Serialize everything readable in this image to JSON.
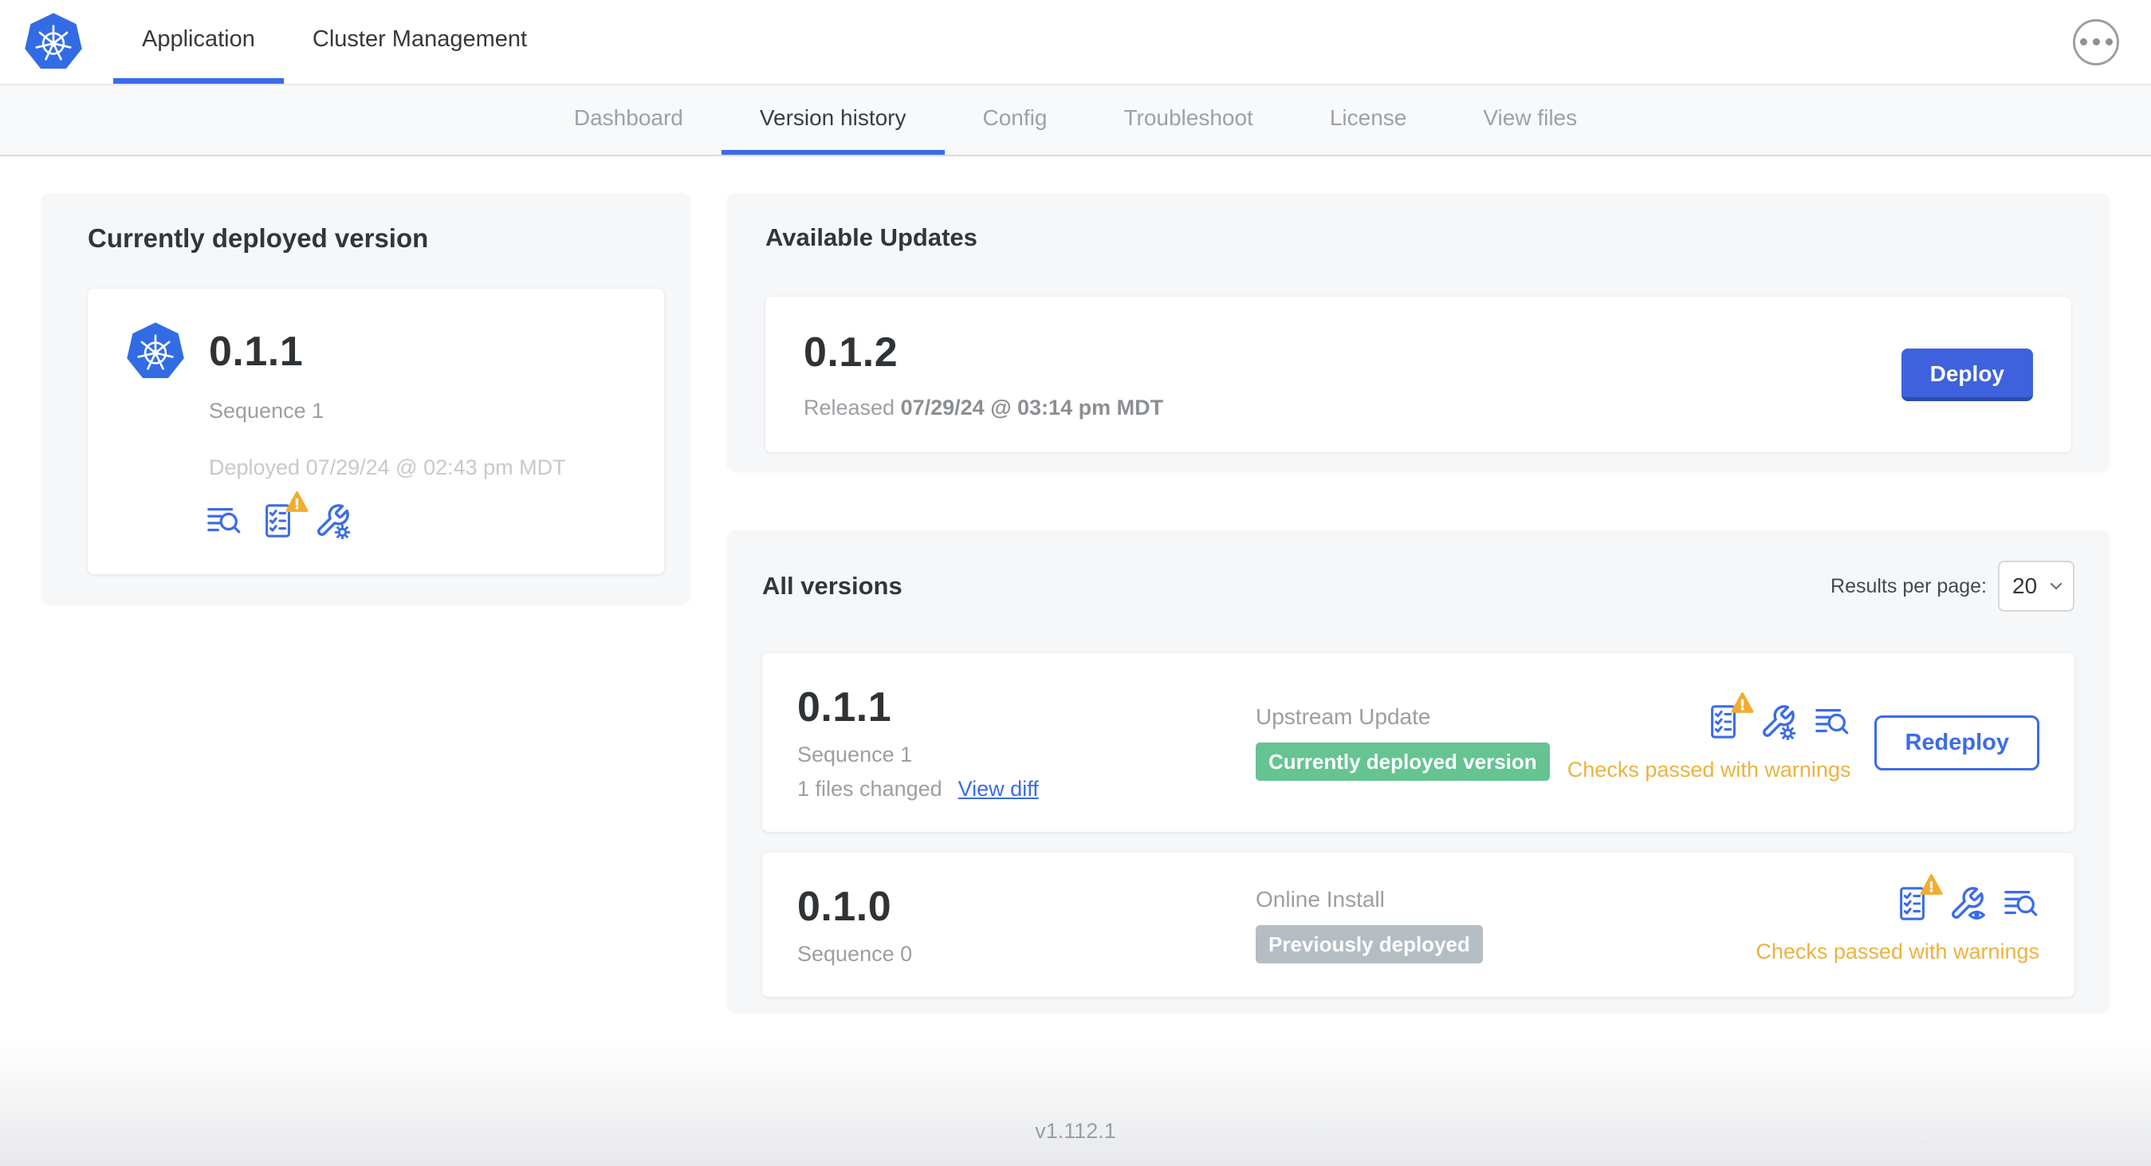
{
  "header": {
    "tabs": [
      {
        "label": "Application",
        "active": true
      },
      {
        "label": "Cluster Management",
        "active": false
      }
    ]
  },
  "subnav": {
    "tabs": [
      {
        "label": "Dashboard",
        "active": false
      },
      {
        "label": "Version history",
        "active": true
      },
      {
        "label": "Config",
        "active": false
      },
      {
        "label": "Troubleshoot",
        "active": false
      },
      {
        "label": "License",
        "active": false
      },
      {
        "label": "View files",
        "active": false
      }
    ]
  },
  "current_version": {
    "title": "Currently deployed version",
    "version": "0.1.1",
    "sequence": "Sequence 1",
    "deployed": "Deployed 07/29/24 @ 02:43 pm MDT"
  },
  "available_updates": {
    "title": "Available Updates",
    "version": "0.1.2",
    "released_prefix": "Released",
    "released_timestamp": "07/29/24 @ 03:14 pm MDT",
    "deploy_label": "Deploy"
  },
  "all_versions": {
    "title": "All versions",
    "results_per_page_label": "Results per page:",
    "results_per_page_value": "20",
    "rows": [
      {
        "version": "0.1.1",
        "sequence": "Sequence 1",
        "files_changed": "1 files changed",
        "view_diff": "View diff",
        "source": "Upstream Update",
        "badge": "Currently deployed version",
        "status": "Checks passed with warnings",
        "action": "Redeploy"
      },
      {
        "version": "0.1.0",
        "sequence": "Sequence 0",
        "source": "Online Install",
        "badge": "Previously deployed",
        "status": "Checks passed with warnings"
      }
    ]
  },
  "footer": {
    "app_version": "v1.112.1"
  },
  "icons": {
    "logo": "kubernetes-logo",
    "menu": "ellipsis-icon",
    "logs": "logs-icon",
    "preflight": "preflight-checks-icon",
    "warning": "warning-triangle-icon",
    "config_gear": "wrench-gear-icon",
    "config_eye": "wrench-eye-icon",
    "chevron": "chevron-down-icon"
  },
  "colors": {
    "logo_blue": "#326CE5",
    "accent_blue": "#3b6ce8",
    "button_blue": "#3e62dd",
    "green_badge": "#65c492",
    "gray_badge": "#b4bec2",
    "warning_amber": "#ecb23e",
    "text_dark": "#323639",
    "text_gray": "#9b9fa3"
  }
}
